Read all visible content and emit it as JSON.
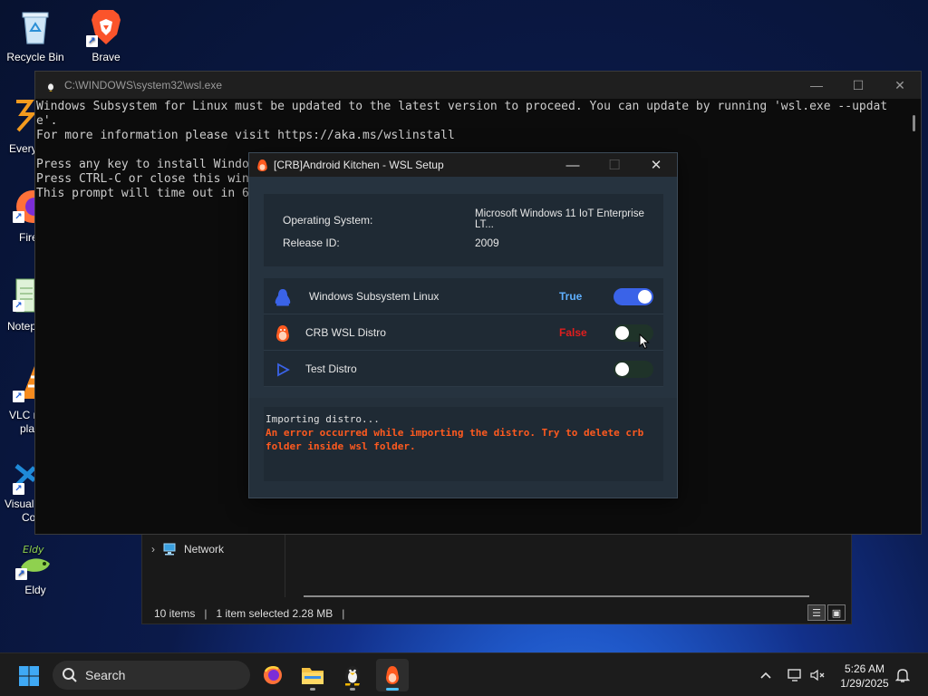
{
  "desktop": {
    "icons": [
      {
        "label": "Recycle Bin"
      },
      {
        "label": "Brave"
      },
      {
        "label": "Eldy"
      }
    ],
    "partial_labels": [
      "Every",
      "Fire",
      "Notep",
      "VLC m",
      "pla",
      "Visual",
      "Co"
    ]
  },
  "console": {
    "title": "C:\\WINDOWS\\system32\\wsl.exe",
    "text": "Windows Subsystem for Linux must be updated to the latest version to proceed. You can update by running 'wsl.exe --updat\ne'.\nFor more information please visit https://aka.ms/wslinstall\n\nPress any key to install Windo\nPress CTRL-C or close this win\nThis prompt will time out in 6"
  },
  "dialog": {
    "title": "[CRB]Android Kitchen - WSL Setup",
    "os_label": "Operating System:",
    "os_value": "Microsoft Windows 11 IoT Enterprise LT...",
    "release_label": "Release ID:",
    "release_value": "2009",
    "rows": [
      {
        "label": "Windows Subsystem Linux",
        "status": "True",
        "status_color": "#5fb0ff",
        "enabled": true
      },
      {
        "label": "CRB WSL Distro",
        "status": "False",
        "status_color": "#e01e1e",
        "enabled": false
      },
      {
        "label": "Test Distro",
        "status": "",
        "enabled": false
      }
    ],
    "log_line1": "Importing distro...",
    "log_error": "An error occurred while importing the distro. Try to delete crb folder inside wsl folder."
  },
  "explorer": {
    "nav_item": "Network",
    "items_count": "10 items",
    "selection": "1 item selected  2.28 MB"
  },
  "taskbar": {
    "search_label": "Search",
    "time": "5:26 AM",
    "date": "1/29/2025"
  },
  "colors": {
    "accent": "#3a63e8",
    "error": "#ff5a1f",
    "true_status": "#5fb0ff",
    "false_status": "#e01e1e"
  }
}
